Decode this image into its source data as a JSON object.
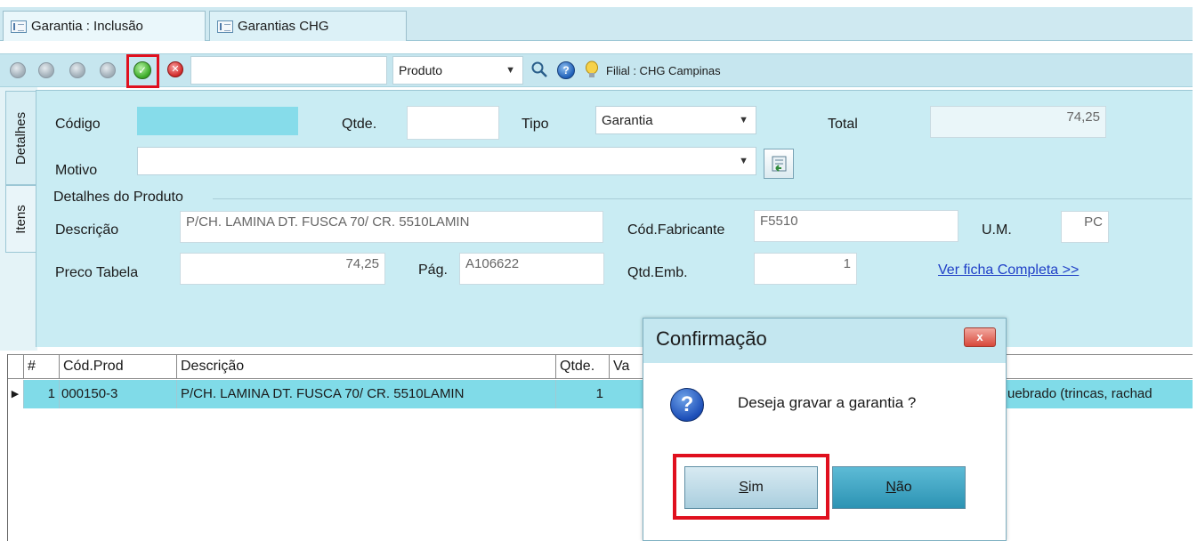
{
  "tabs": [
    {
      "label": "Garantia : Inclusão",
      "active": true
    },
    {
      "label": "Garantias CHG",
      "active": false
    }
  ],
  "toolbar": {
    "search_value": "",
    "search_field": "Produto",
    "filial": "Filial : CHG Campinas",
    "icons": [
      "first-icon",
      "prev-icon",
      "next-icon",
      "last-icon",
      "confirm-icon",
      "cancel-icon",
      "search-icon",
      "help-icon",
      "tip-icon"
    ]
  },
  "side_tabs": [
    "Detalhes",
    "Itens"
  ],
  "form": {
    "codigo_label": "Código",
    "codigo_value": "",
    "qtde_label": "Qtde.",
    "qtde_value": "",
    "tipo_label": "Tipo",
    "tipo_value": "Garantia",
    "total_label": "Total",
    "total_value": "74,25",
    "motivo_label": "Motivo",
    "motivo_value": ""
  },
  "produto": {
    "section_title": "Detalhes do Produto",
    "descricao_label": "Descrição",
    "descricao_value": "P/CH. LAMINA DT. FUSCA 70/ CR. 5510LAMIN",
    "cod_fabricante_label": "Cód.Fabricante",
    "cod_fabricante_value": "F5510",
    "um_label": "U.M.",
    "um_value": "PC",
    "preco_label": "Preco Tabela",
    "preco_value": "74,25",
    "pag_label": "Pág.",
    "pag_value": "A106622",
    "qtd_emb_label": "Qtd.Emb.",
    "qtd_emb_value": "1",
    "ficha_link": "Ver ficha Completa >>"
  },
  "grid": {
    "headers": [
      "#",
      "Cód.Prod",
      "Descrição",
      "Qtde.",
      "Va"
    ],
    "rows": [
      {
        "num": "1",
        "cod": "000150-3",
        "desc": "P/CH. LAMINA DT. FUSCA 70/ CR. 5510LAMIN",
        "qtde": "1",
        "motivo_tail": "uebrado (trincas, rachad"
      }
    ]
  },
  "dialog": {
    "title": "Confirmação",
    "close": "x",
    "message": "Deseja gravar a garantia ?",
    "yes_accel": "S",
    "yes_rest": "im",
    "no_accel": "N",
    "no_rest": "ão",
    "icon": "question-icon"
  },
  "colors": {
    "highlight_frame": "#e0101e",
    "selected_row": "#80dbe8",
    "panel_bg": "#c9ecf3"
  }
}
